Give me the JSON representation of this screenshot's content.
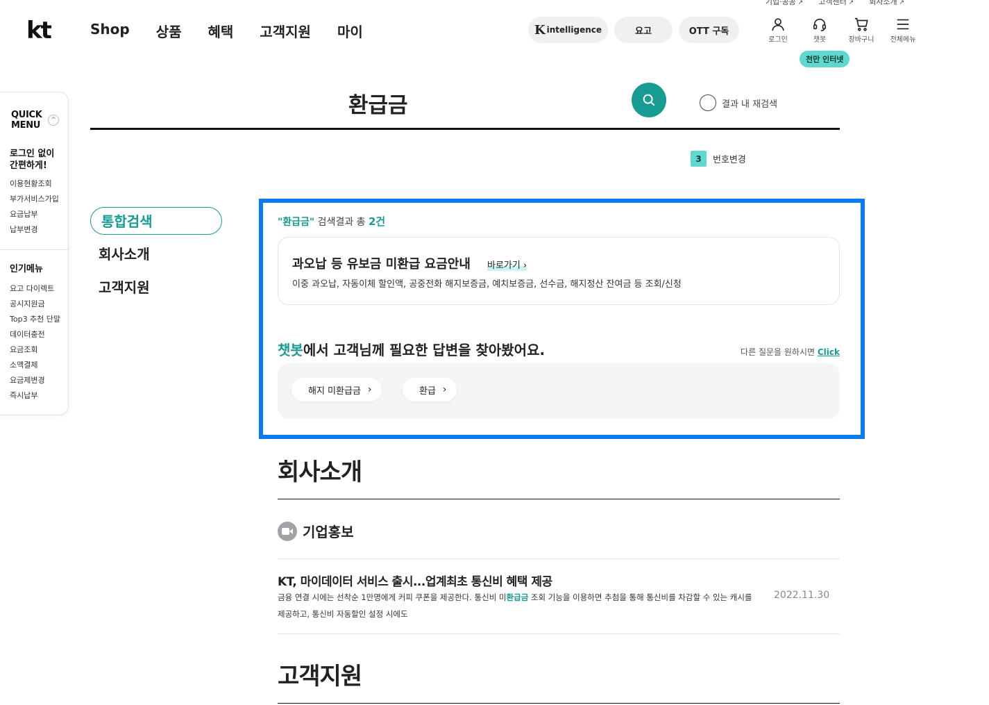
{
  "header": {
    "util_links": [
      "기업·공공",
      "고객센터",
      "회사소개"
    ],
    "logo": "kt",
    "nav": [
      "Shop",
      "상품",
      "혜택",
      "고객지원",
      "마이"
    ],
    "pills": {
      "k_mark": "K",
      "k_text": "intelligence",
      "yogo": "요고",
      "ott": "OTT 구독"
    },
    "icons": [
      {
        "label": "로그인",
        "icon": "person-icon"
      },
      {
        "label": "챗봇",
        "icon": "headset-icon"
      },
      {
        "label": "장바구니",
        "icon": "cart-icon"
      },
      {
        "label": "전체메뉴",
        "icon": "hamburger-icon"
      }
    ],
    "tooltip": "천만 인터넷"
  },
  "quick_menu": {
    "title_line1": "QUICK",
    "title_line2": "MENU",
    "toggle": "^",
    "sec1_title_line1": "로그인 없이",
    "sec1_title_line2": "간편하게!",
    "sec1_items": [
      "이용현황조회",
      "부가서비스가입",
      "요금납부",
      "납부변경"
    ],
    "sec2_title": "인기메뉴",
    "sec2_items": [
      "요고 다이렉트",
      "공시지원금",
      "Top3 추천 단말",
      "데이터충전",
      "요금조회",
      "소액결제",
      "요금제변경",
      "즉시납부"
    ]
  },
  "search": {
    "term": "환급금",
    "research_label": "결과 내 재검색",
    "number_badge": "3",
    "number_change_label": "번호변경"
  },
  "lnb": {
    "items": [
      "통합검색",
      "회사소개",
      "고객지원"
    ],
    "active": "통합검색"
  },
  "results": {
    "count_term": "\"환급금\"",
    "count_mid": " 검색결과 총 ",
    "count_num": "2건",
    "service": {
      "title": "과오납 등 유보금 미환급 요금안내",
      "link": "바로가기",
      "desc": "이중 과오납, 자동이체 할인액, 공중전화 해지보증금, 예치보증금, 선수금, 해지정산 잔여금 등 조회/신청"
    },
    "chatbot": {
      "accent": "챗봇",
      "rest": "에서 고객님께 필요한 답변을 찾아봤어요.",
      "more_text": "다른 질문을 원하시면 ",
      "more_click": "Click",
      "chips": [
        "해지 미환급금",
        "환급"
      ]
    }
  },
  "company": {
    "title": "회사소개",
    "sub_title": "기업홍보",
    "news_title": "KT, 마이데이터 서비스 출시...업계최초 통신비 혜택 제공",
    "news_desc_pre": "금융 연결 시에는 선착순 1만명에게 커피 쿠폰을 제공한다. 통신비 미",
    "news_desc_hl": "환급금",
    "news_desc_post": " 조회 기능을 이용하면 추첨을 통해 통신비를 차감할 수 있는 캐시를 제공하고, 통신비 자동할인 설정 시에도",
    "news_date": "2022.11.30"
  },
  "support": {
    "title": "고객지원"
  },
  "colors": {
    "brand": "#169c93",
    "highlight_border": "#0a7cf0",
    "logo_red": "#e60012",
    "tooltip": "#5fd9cf"
  }
}
